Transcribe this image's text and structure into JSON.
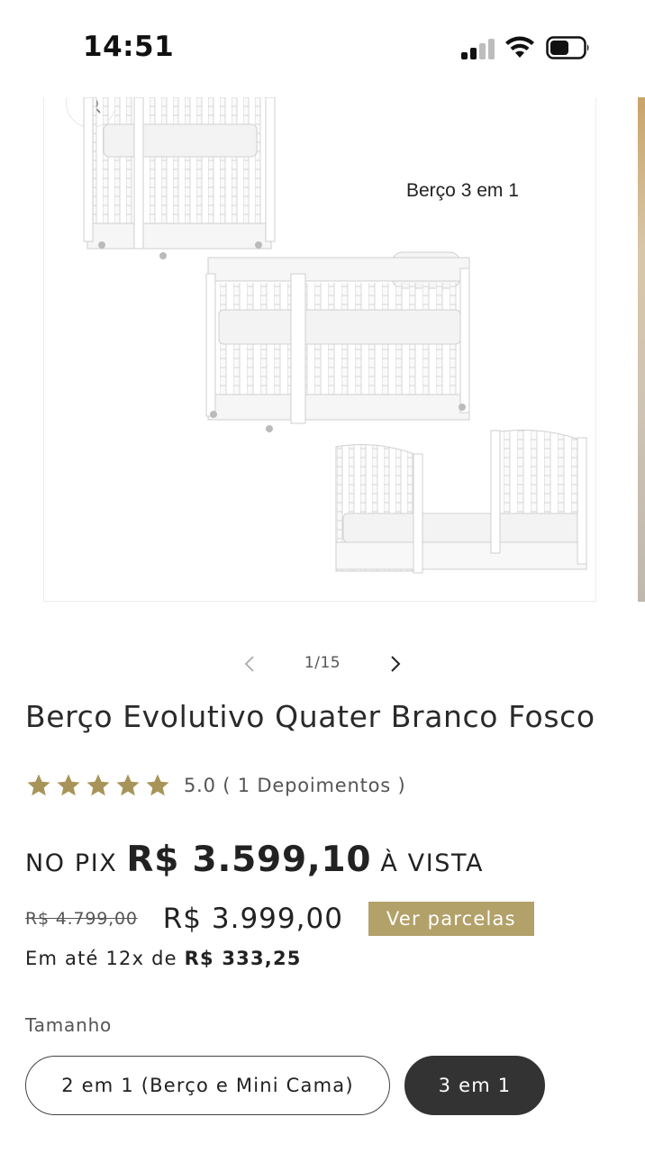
{
  "status_bar": {
    "time": "14:51"
  },
  "gallery": {
    "caption": "Berço 3 em 1",
    "counter": "1/15"
  },
  "product": {
    "title": "Berço Evolutivo Quater Branco Fosco",
    "rating": {
      "stars": 5,
      "text": "5.0 ( 1  Depoimentos )"
    },
    "pix": {
      "label": "NO PIX",
      "price": "R$ 3.599,10",
      "suffix": "À VISTA"
    },
    "old_price": "R$ 4.799,00",
    "current_price": "R$ 3.999,00",
    "installments_button": "Ver parcelas",
    "installments": {
      "prefix": "Em até 12x de",
      "amount": "R$ 333,25"
    },
    "size": {
      "label": "Tamanho",
      "options": [
        "2 em 1 (Berço e Mini Cama)",
        "3 em 1"
      ],
      "selected": "3 em 1"
    }
  },
  "colors": {
    "accent_gold": "#b3a16a",
    "star_gold": "#a89458",
    "selected_option_bg": "#333333"
  }
}
